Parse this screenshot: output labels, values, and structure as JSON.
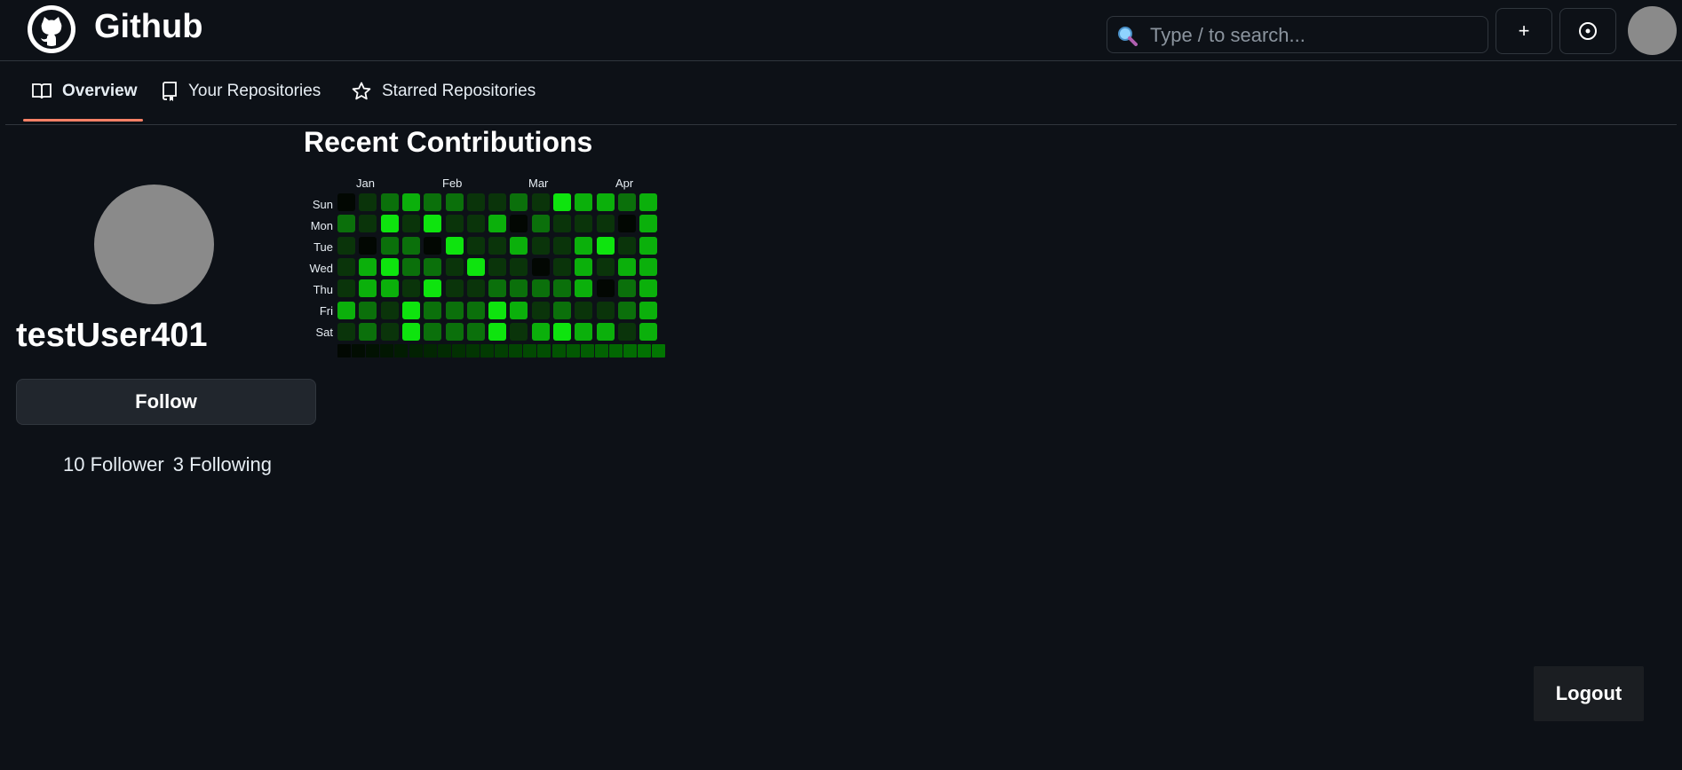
{
  "header": {
    "title": "Github",
    "logo_icon": "github-octocat-icon",
    "search_placeholder": "Type / to search...",
    "plus_label": "+",
    "issue_icon": "issue-circle-icon"
  },
  "tabs": [
    {
      "label": "Overview",
      "icon": "book-open-icon",
      "active": true
    },
    {
      "label": "Your Repositories",
      "icon": "repo-icon",
      "active": false
    },
    {
      "label": "Starred Repositories",
      "icon": "star-icon",
      "active": false
    }
  ],
  "profile": {
    "username": "testUser401",
    "follow_label": "Follow",
    "followers": "10 Follower",
    "following": "3 Following"
  },
  "contributions": {
    "title": "Recent Contributions",
    "months": [
      "Jan",
      "Feb",
      "Mar",
      "Apr"
    ],
    "days": [
      "Sun",
      "Mon",
      "Tue",
      "Wed",
      "Thu",
      "Fri",
      "Sat"
    ],
    "levels": [
      [
        0,
        1,
        2,
        3,
        2,
        2,
        1,
        1,
        2,
        1,
        4,
        3,
        3,
        2,
        3
      ],
      [
        2,
        1,
        4,
        1,
        4,
        1,
        1,
        3,
        0,
        2,
        1,
        1,
        1,
        0,
        3
      ],
      [
        1,
        0,
        2,
        2,
        0,
        4,
        1,
        1,
        3,
        1,
        1,
        3,
        4,
        1,
        3
      ],
      [
        1,
        3,
        4,
        2,
        2,
        1,
        4,
        1,
        1,
        0,
        1,
        3,
        1,
        3,
        3
      ],
      [
        1,
        3,
        3,
        1,
        4,
        1,
        1,
        2,
        2,
        2,
        2,
        3,
        0,
        2,
        3
      ],
      [
        3,
        2,
        1,
        4,
        2,
        2,
        2,
        4,
        3,
        1,
        2,
        1,
        1,
        2,
        3
      ],
      [
        1,
        2,
        1,
        4,
        2,
        2,
        2,
        4,
        1,
        3,
        4,
        3,
        3,
        1,
        3
      ]
    ],
    "palette": [
      "#020702",
      "#0a340a",
      "#0b700b",
      "#0bb00b",
      "#0ee40e"
    ]
  },
  "logout_label": "Logout"
}
